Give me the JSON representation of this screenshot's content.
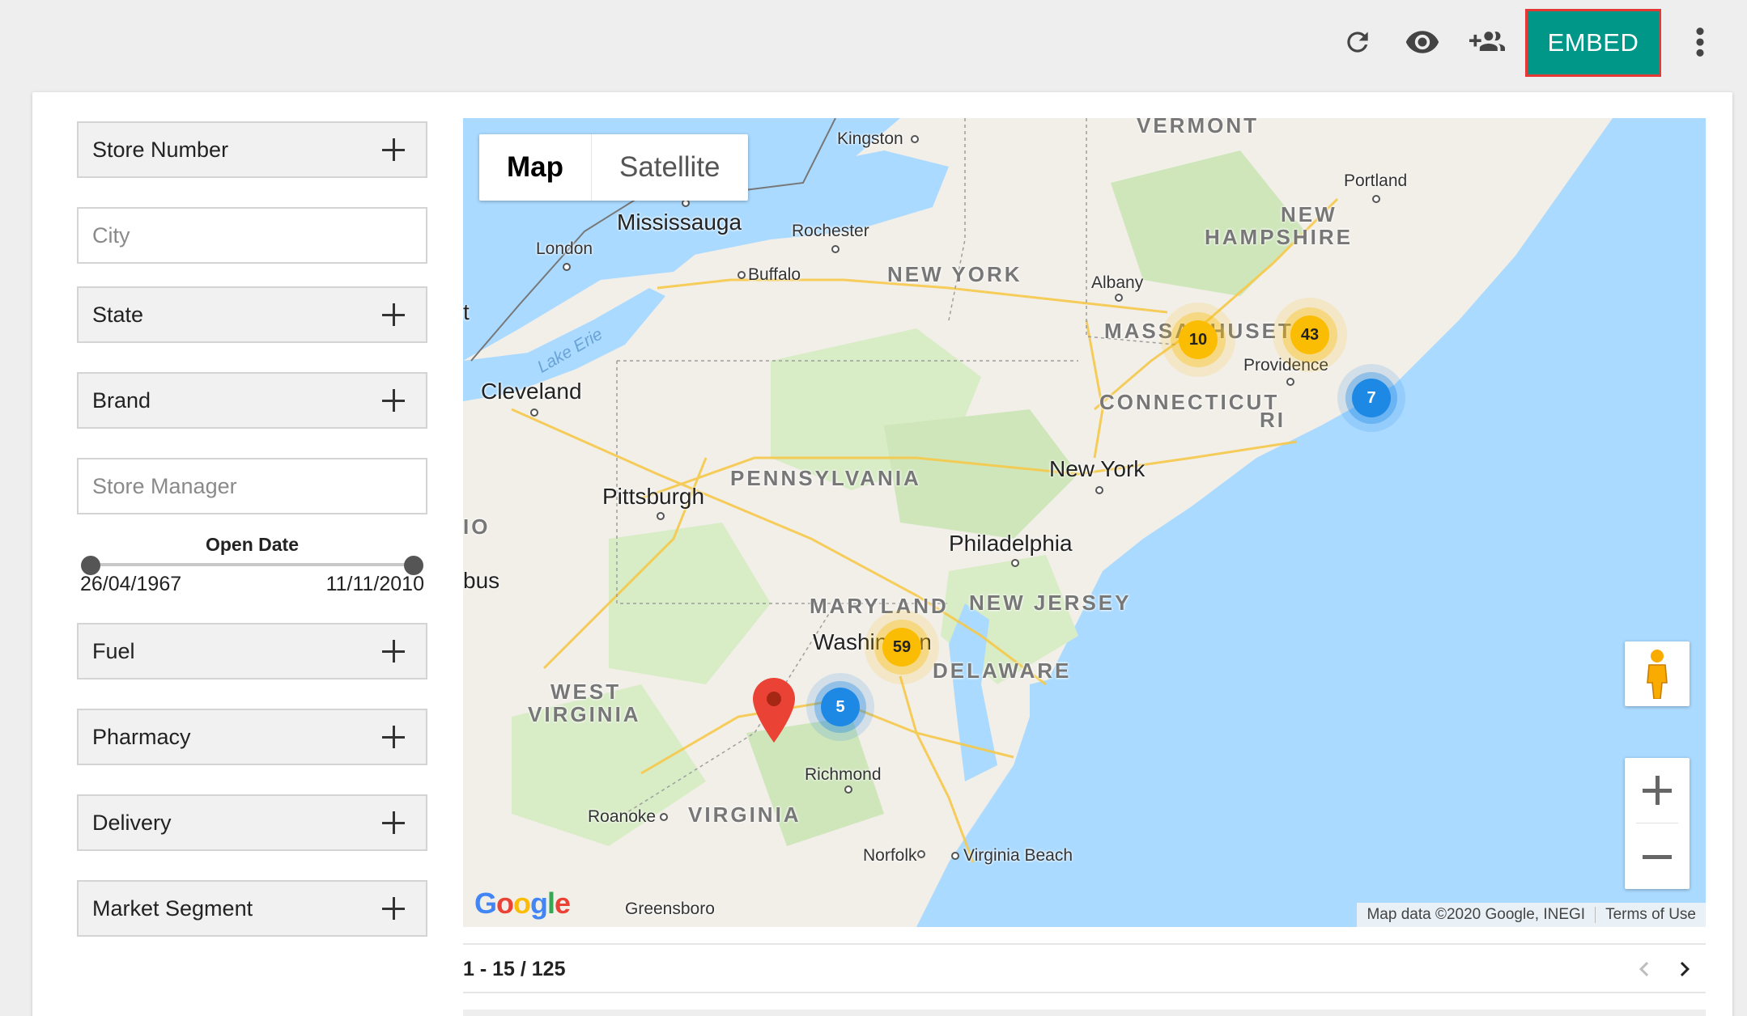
{
  "toolbar": {
    "refresh_icon": "refresh-icon",
    "preview_icon": "eye-icon",
    "share_icon": "add-people-icon",
    "embed_label": "EMBED",
    "more_icon": "more-vert-icon",
    "embed_color": "#009688",
    "embed_border_color": "#e53935"
  },
  "filters": {
    "store_number": "Store Number",
    "city_placeholder": "City",
    "state": "State",
    "brand": "Brand",
    "store_manager_placeholder": "Store Manager",
    "open_date": {
      "title": "Open Date",
      "start": "26/04/1967",
      "end": "11/11/2010"
    },
    "fuel": "Fuel",
    "pharmacy": "Pharmacy",
    "delivery": "Delivery",
    "market_segment": "Market Segment"
  },
  "map": {
    "type_map": "Map",
    "type_satellite": "Satellite",
    "selected_type": "Map",
    "labels": {
      "vermont": "VERMONT",
      "kingston": "Kingston",
      "portland": "Portland",
      "mississauga": "Mississauga",
      "rochester": "Rochester",
      "new_hampshire_1": "NEW",
      "new_hampshire_2": "HAMPSHIRE",
      "london": "London",
      "buffalo": "Buffalo",
      "new_york_state": "NEW YORK",
      "albany": "Albany",
      "massachusetts": "MASSACHUSETTS",
      "providence": "Providence",
      "lake_erie": "Lake Erie",
      "cleveland": "Cleveland",
      "connecticut": "CONNECTICUT",
      "ri": "RI",
      "new_york_city": "New York",
      "pennsylvania": "PENNSYLVANIA",
      "pittsburgh": "Pittsburgh",
      "io": "IO",
      "philadelphia": "Philadelphia",
      "bus": "bus",
      "maryland": "MARYLAND",
      "new_jersey": "NEW JERSEY",
      "washington": "Washington",
      "delaware": "DELAWARE",
      "west_virginia_1": "WEST",
      "west_virginia_2": "VIRGINIA",
      "richmond": "Richmond",
      "roanoke": "Roanoke",
      "virginia": "VIRGINIA",
      "norfolk": "Norfolk",
      "virginia_beach": "Virginia Beach",
      "greensboro": "Greensboro",
      "t": "t"
    },
    "clusters": [
      {
        "count": "10",
        "color": "yellow"
      },
      {
        "count": "43",
        "color": "yellow"
      },
      {
        "count": "7",
        "color": "blue"
      },
      {
        "count": "59",
        "color": "yellow"
      },
      {
        "count": "5",
        "color": "blue"
      }
    ],
    "marker_icon": "map-pin-icon",
    "pegman_icon": "pegman-icon",
    "zoom_in_icon": "plus-icon",
    "zoom_out_icon": "minus-icon",
    "google_logo": "Google",
    "attribution": "Map data ©2020 Google, INEGI",
    "terms": "Terms of Use"
  },
  "pagination": {
    "text": "1 - 15 / 125",
    "prev_icon": "chevron-left-icon",
    "next_icon": "chevron-right-icon"
  }
}
